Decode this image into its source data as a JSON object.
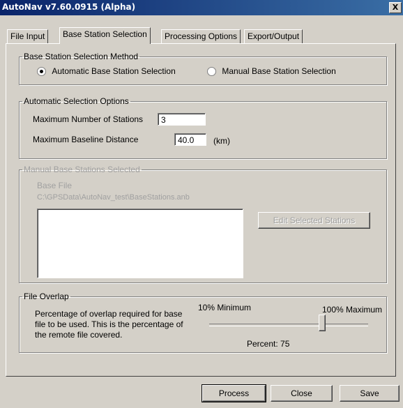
{
  "window": {
    "title": "AutoNav v7.60.0915 (Alpha)",
    "close_glyph": "X"
  },
  "tabs": [
    {
      "label": "File Input",
      "active": false
    },
    {
      "label": "Base Station Selection",
      "active": true
    },
    {
      "label": "Processing Options",
      "active": false
    },
    {
      "label": "Export/Output",
      "active": false
    }
  ],
  "method": {
    "legend": "Base Station Selection Method",
    "automatic_label": "Automatic Base Station Selection",
    "manual_label": "Manual Base Station Selection",
    "selected": "automatic"
  },
  "auto_options": {
    "legend": "Automatic Selection Options",
    "max_stations_label": "Maximum Number of Stations",
    "max_stations_value": "3",
    "max_baseline_label": "Maximum Baseline Distance",
    "max_baseline_value": "40.0",
    "max_baseline_unit": "(km)"
  },
  "manual": {
    "legend": "Manual Base Stations Selected",
    "base_file_label": "Base File",
    "base_file_path": "C:\\GPSData\\AutoNav_test\\BaseStations.anb",
    "edit_button": "Edit Selected Stations"
  },
  "overlap": {
    "legend": "File Overlap",
    "description": "Percentage of overlap required for base file to be used.  This is the percentage of the remote file covered.",
    "min_label": "10% Minimum",
    "max_label": "100% Maximum",
    "percent_text": "Percent: 75",
    "value": 75,
    "min": 10,
    "max": 100
  },
  "buttons": {
    "process": "Process",
    "close": "Close",
    "save": "Save"
  }
}
